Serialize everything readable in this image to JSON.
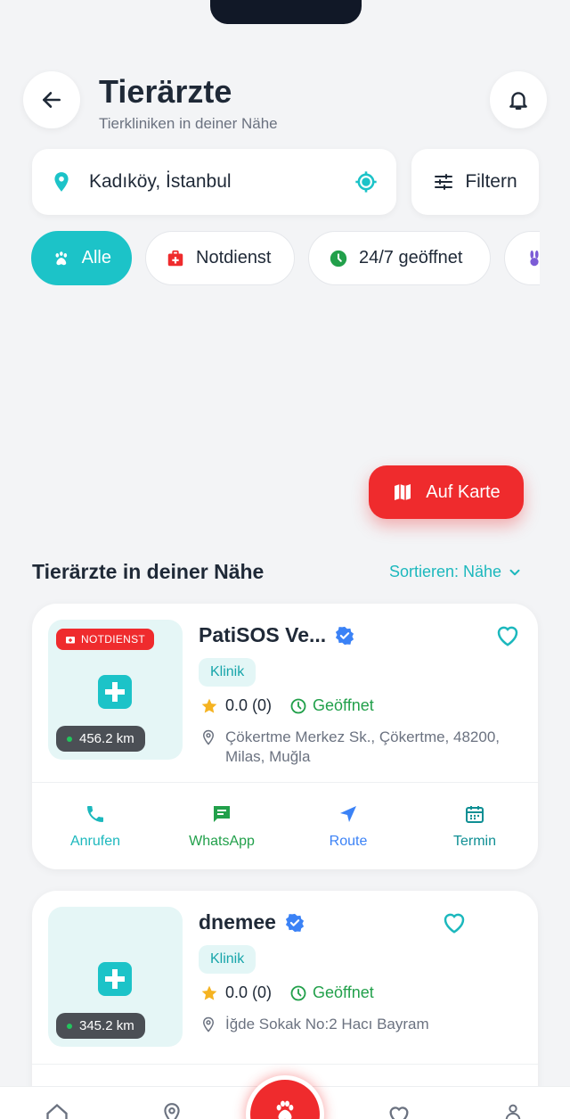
{
  "header": {
    "title": "Tierärzte",
    "subtitle": "Tierkliniken in deiner Nähe"
  },
  "location": {
    "value": "Kadıköy, İstanbul"
  },
  "filter": {
    "label": "Filtern"
  },
  "chips": [
    {
      "label": "Alle",
      "icon": "paw-icon",
      "active": true
    },
    {
      "label": "Notdienst",
      "icon": "first-aid-icon",
      "active": false
    },
    {
      "label": "24/7 geöffnet",
      "icon": "clock-icon",
      "active": false
    },
    {
      "label": "",
      "icon": "rabbit-icon",
      "active": false
    }
  ],
  "map_button": {
    "label": "Auf Karte"
  },
  "list": {
    "title": "Tierärzte in deiner Nähe",
    "sort_label": "Sortieren: Nähe"
  },
  "clinics": [
    {
      "name": "PatiSOS Ve...",
      "verified": true,
      "emergency_badge": "NOTDIENST",
      "distance": "456.2 km",
      "tag": "Klinik",
      "rating": "0.0 (0)",
      "status": "Geöffnet",
      "address": "Çökertme Merkez Sk., Çökertme, 48200, Milas, Muğla"
    },
    {
      "name": "dnemee",
      "verified": true,
      "distance": "345.2 km",
      "tag": "Klinik",
      "rating": "0.0 (0)",
      "status": "Geöffnet",
      "address": "İğde Sokak No:2 Hacı Bayram"
    }
  ],
  "actions": [
    {
      "label": "Anrufen",
      "icon": "phone-icon",
      "color": "#1cb8bd"
    },
    {
      "label": "WhatsApp",
      "icon": "message-icon",
      "color": "#22a04b"
    },
    {
      "label": "Route",
      "icon": "navigation-icon",
      "color": "#3b82f6"
    },
    {
      "label": "Termin",
      "icon": "calendar-icon",
      "color": "#0f8f94"
    }
  ],
  "colors": {
    "accent": "#1cc3c8",
    "emergency": "#ef2b2d",
    "open": "#22a04b",
    "verified": "#3b82f6"
  }
}
